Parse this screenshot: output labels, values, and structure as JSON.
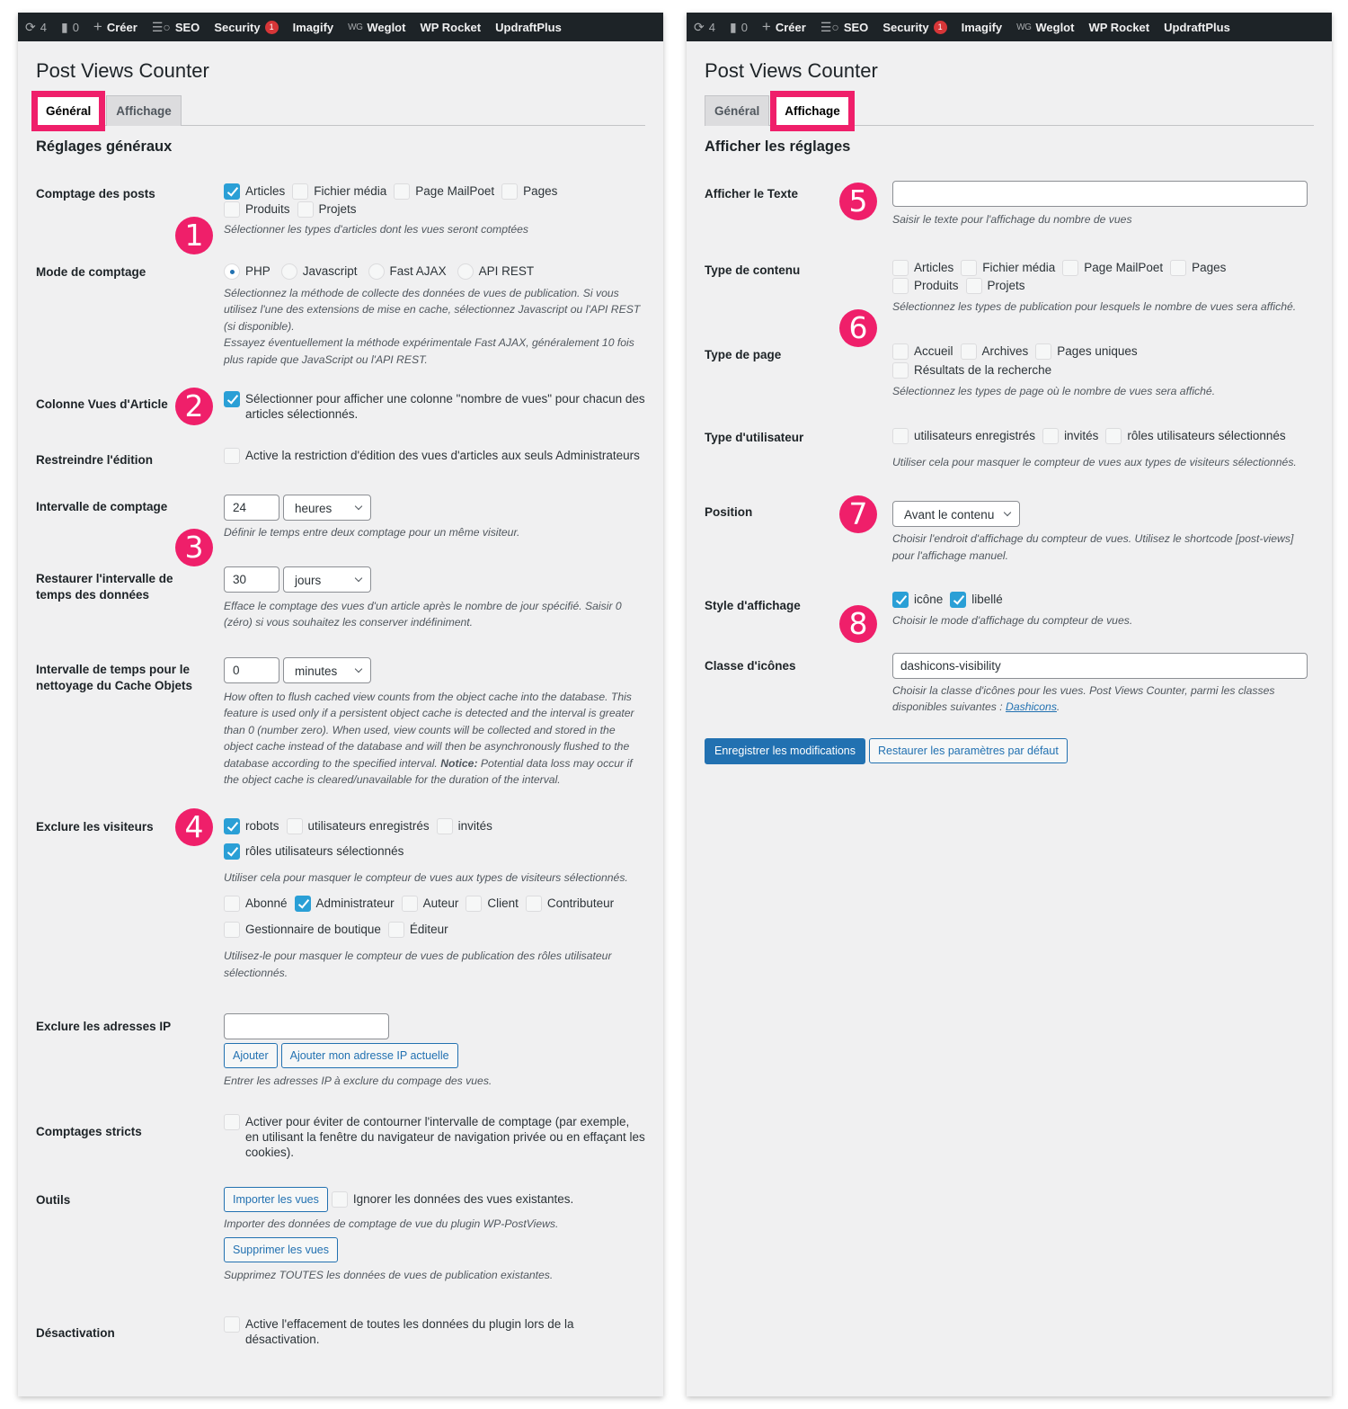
{
  "adminbar": {
    "updates_count": "4",
    "comments_count": "0",
    "create_label": "Créer",
    "seo_label": "SEO",
    "security_label": "Security",
    "security_badge": "1",
    "imagify_label": "Imagify",
    "weglot_prefix": "WG",
    "weglot_label": "Weglot",
    "wprocket_label": "WP Rocket",
    "updraftplus_label": "UpdraftPlus"
  },
  "left": {
    "page_title": "Post Views Counter",
    "tabs": [
      {
        "label": "Général",
        "active": true
      },
      {
        "label": "Affichage",
        "active": false
      }
    ],
    "section_title": "Réglages généraux",
    "post_count": {
      "label": "Comptage des posts",
      "options": [
        {
          "label": "Articles",
          "checked": true
        },
        {
          "label": "Fichier média",
          "checked": false
        },
        {
          "label": "Page MailPoet",
          "checked": false
        },
        {
          "label": "Pages",
          "checked": false
        },
        {
          "label": "Produits",
          "checked": false
        },
        {
          "label": "Projets",
          "checked": false
        }
      ],
      "description": "Sélectionner les types d'articles dont les vues seront comptées"
    },
    "count_mode": {
      "label": "Mode de comptage",
      "options": [
        {
          "label": "PHP",
          "selected": true
        },
        {
          "label": "Javascript",
          "selected": false
        },
        {
          "label": "Fast AJAX",
          "selected": false
        },
        {
          "label": "API REST",
          "selected": false
        }
      ],
      "description_1": "Sélectionnez la méthode de collecte des données de vues de publication. Si vous utilisez l'une des extensions de mise en cache, sélectionnez Javascript ou l'API REST (si disponible).",
      "description_2": "Essayez éventuellement la méthode expérimentale Fast AJAX, généralement 10 fois plus rapide que JavaScript ou l'API REST."
    },
    "post_views_column": {
      "label": "Colonne Vues d'Article",
      "checked": true,
      "text": "Sélectionner pour afficher une colonne \"nombre de vues\" pour chacun des articles sélectionnés."
    },
    "restrict_edit": {
      "label": "Restreindre l'édition",
      "checked": false,
      "text": "Active la restriction d'édition des vues d'articles aux seuls Administrateurs"
    },
    "count_interval": {
      "label": "Intervalle de comptage",
      "value": "24",
      "unit": "heures",
      "description": "Définir le temps entre deux comptage pour un même visiteur."
    },
    "reset_interval": {
      "label": "Restaurer l'intervalle de temps des données",
      "value": "30",
      "unit": "jours",
      "description": "Efface le comptage des vues d'un article après le nombre de jour spécifié. Saisir 0 (zéro) si vous souhaitez les conserver indéfiniment."
    },
    "flush_interval": {
      "label": "Intervalle de temps pour le nettoyage du Cache Objets",
      "value": "0",
      "unit": "minutes",
      "description": "How often to flush cached view counts from the object cache into the database. This feature is used only if a persistent object cache is detected and the interval is greater than 0 (number zero). When used, view counts will be collected and stored in the object cache instead of the database and will then be asynchronously flushed to the database according to the specified interval.",
      "notice_label": "Notice:",
      "notice_text": " Potential data loss may occur if the object cache is cleared/unavailable for the duration of the interval."
    },
    "exclude_visitors": {
      "label": "Exclure les visiteurs",
      "options": [
        {
          "label": "robots",
          "checked": true
        },
        {
          "label": "utilisateurs enregistrés",
          "checked": false
        },
        {
          "label": "invités",
          "checked": false
        },
        {
          "label": "rôles utilisateurs sélectionnés",
          "checked": true
        }
      ],
      "description": "Utiliser cela pour masquer le compteur de vues aux types de visiteurs sélectionnés.",
      "roles": [
        {
          "label": "Abonné",
          "checked": false
        },
        {
          "label": "Administrateur",
          "checked": true
        },
        {
          "label": "Auteur",
          "checked": false
        },
        {
          "label": "Client",
          "checked": false
        },
        {
          "label": "Contributeur",
          "checked": false
        },
        {
          "label": "Gestionnaire de boutique",
          "checked": false
        },
        {
          "label": "Éditeur",
          "checked": false
        }
      ],
      "roles_description": "Utilisez-le pour masquer le compteur de vues de publication des rôles utilisateur sélectionnés."
    },
    "exclude_ips": {
      "label": "Exclure les adresses IP",
      "value": "",
      "add_button": "Ajouter",
      "add_current_button": "Ajouter mon adresse IP actuelle",
      "description": "Entrer les adresses IP à exclure du compage des vues."
    },
    "strict_counts": {
      "label": "Comptages stricts",
      "checked": false,
      "text": "Activer pour éviter de contourner l'intervalle de comptage (par exemple, en utilisant la fenêtre du navigateur de navigation privée ou en effaçant les cookies)."
    },
    "tools": {
      "label": "Outils",
      "import_button": "Importer les vues",
      "ignore_checked": false,
      "ignore_label": "Ignorer les données des vues existantes.",
      "import_description": "Importer des données de comptage de vue du plugin WP-PostViews.",
      "delete_button": "Supprimer les vues",
      "delete_description": "Supprimez TOUTES les données de vues de publication existantes."
    },
    "deactivation": {
      "label": "Désactivation",
      "checked": false,
      "text": "Active l'effacement de toutes les données du plugin lors de la désactivation."
    }
  },
  "right": {
    "page_title": "Post Views Counter",
    "tabs": [
      {
        "label": "Général",
        "active": false
      },
      {
        "label": "Affichage",
        "active": true
      }
    ],
    "section_title": "Afficher les réglages",
    "display_text": {
      "label": "Afficher le Texte",
      "value": "",
      "description": "Saisir le texte pour l'affichage du nombre de vues"
    },
    "content_type": {
      "label": "Type de contenu",
      "options": [
        {
          "label": "Articles",
          "checked": false
        },
        {
          "label": "Fichier média",
          "checked": false
        },
        {
          "label": "Page MailPoet",
          "checked": false
        },
        {
          "label": "Pages",
          "checked": false
        },
        {
          "label": "Produits",
          "checked": false
        },
        {
          "label": "Projets",
          "checked": false
        }
      ],
      "description": "Sélectionnez les types de publication pour lesquels le nombre de vues sera affiché."
    },
    "page_type": {
      "label": "Type de page",
      "options": [
        {
          "label": "Accueil",
          "checked": false
        },
        {
          "label": "Archives",
          "checked": false
        },
        {
          "label": "Pages uniques",
          "checked": false
        },
        {
          "label": "Résultats de la recherche",
          "checked": false
        }
      ],
      "description": "Sélectionnez les types de page où le nombre de vues sera affiché."
    },
    "user_type": {
      "label": "Type d'utilisateur",
      "options": [
        {
          "label": "utilisateurs enregistrés",
          "checked": false
        },
        {
          "label": "invités",
          "checked": false
        },
        {
          "label": "rôles utilisateurs sélectionnés",
          "checked": false
        }
      ],
      "description": "Utiliser cela pour masquer le compteur de vues aux types de visiteurs sélectionnés."
    },
    "position": {
      "label": "Position",
      "value": "Avant le contenu",
      "description": "Choisir l'endroit d'affichage du compteur de vues. Utilisez le shortcode [post-views] pour l'affichage manuel."
    },
    "display_style": {
      "label": "Style d'affichage",
      "options": [
        {
          "label": "icône",
          "checked": true
        },
        {
          "label": "libellé",
          "checked": true
        }
      ],
      "description": "Choisir le mode d'affichage du compteur de vues."
    },
    "icon_class": {
      "label": "Classe d'icônes",
      "value": "dashicons-visibility",
      "description": "Choisir la classe d'icônes pour les vues. Post Views Counter, parmi les classes disponibles suivantes : ",
      "link_text": "Dashicons",
      "description_end": "."
    },
    "save_button": "Enregistrer les modifications",
    "reset_button": "Restaurer les paramètres par défaut"
  },
  "annotations": [
    "1",
    "2",
    "3",
    "4",
    "5",
    "6",
    "7",
    "8"
  ],
  "colors": {
    "annotation": "#ef1f6a",
    "primary": "#2271b1",
    "checkbox_checked": "#2a9fd6",
    "adminbar": "#1d2327",
    "security_badge": "#d63638"
  }
}
